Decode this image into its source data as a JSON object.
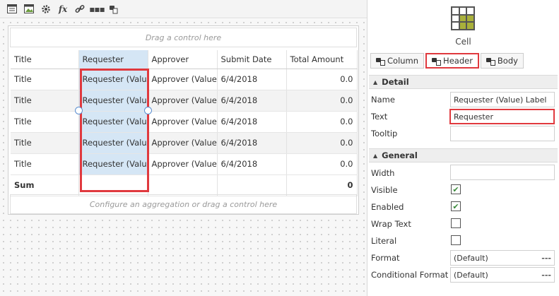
{
  "toolbar": {
    "icons": [
      "form-icon",
      "image-edit-icon",
      "gear-icon",
      "fx-icon",
      "link-icon",
      "more-icon",
      "hat-icon"
    ],
    "fx_label": "fx",
    "more_label": "▪▪▪"
  },
  "grid": {
    "top_drop": "Drag a control here",
    "bottom_drop": "Configure an aggregation or drag a control here",
    "headers": [
      "Title",
      "Requester",
      "Approver",
      "Submit Date",
      "Total Amount"
    ],
    "rows": [
      [
        "Title",
        "Requester (Value) Label",
        "Approver (Value) Label",
        "6/4/2018",
        "0.0"
      ],
      [
        "Title",
        "Requester (Value) Label",
        "Approver (Value) Label",
        "6/4/2018",
        "0.0"
      ],
      [
        "Title",
        "Requester (Value) Label",
        "Approver (Value) Label",
        "6/4/2018",
        "0.0"
      ],
      [
        "Title",
        "Requester (Value) Label",
        "Approver (Value) Label",
        "6/4/2018",
        "0.0"
      ],
      [
        "Title",
        "Requester (Value) Label",
        "Approver (Value) Label",
        "6/4/2018",
        "0.0"
      ]
    ],
    "sum_row": [
      "Sum",
      "",
      "",
      "",
      "0"
    ]
  },
  "panel": {
    "title": "Cell",
    "tabs": [
      {
        "label": "Column",
        "active": false
      },
      {
        "label": "Header",
        "active": true
      },
      {
        "label": "Body",
        "active": false
      }
    ],
    "detail": {
      "heading": "Detail",
      "name_label": "Name",
      "name_value": "Requester (Value) Label",
      "text_label": "Text",
      "text_value": "Requester",
      "tooltip_label": "Tooltip",
      "tooltip_value": ""
    },
    "general": {
      "heading": "General",
      "width_label": "Width",
      "width_value": "",
      "visible_label": "Visible",
      "visible_checked": true,
      "enabled_label": "Enabled",
      "enabled_checked": true,
      "wrap_label": "Wrap Text",
      "wrap_checked": false,
      "literal_label": "Literal",
      "literal_checked": false,
      "format_label": "Format",
      "format_value": "(Default)",
      "condfmt_label": "Conditional Format",
      "condfmt_value": "(Default)",
      "more_label": "---"
    }
  },
  "colors": {
    "highlight": "#e0393e",
    "selection": "#d5e6f5",
    "check": "#3a8a3a",
    "cell_icon_accent": "#a9b03a"
  }
}
